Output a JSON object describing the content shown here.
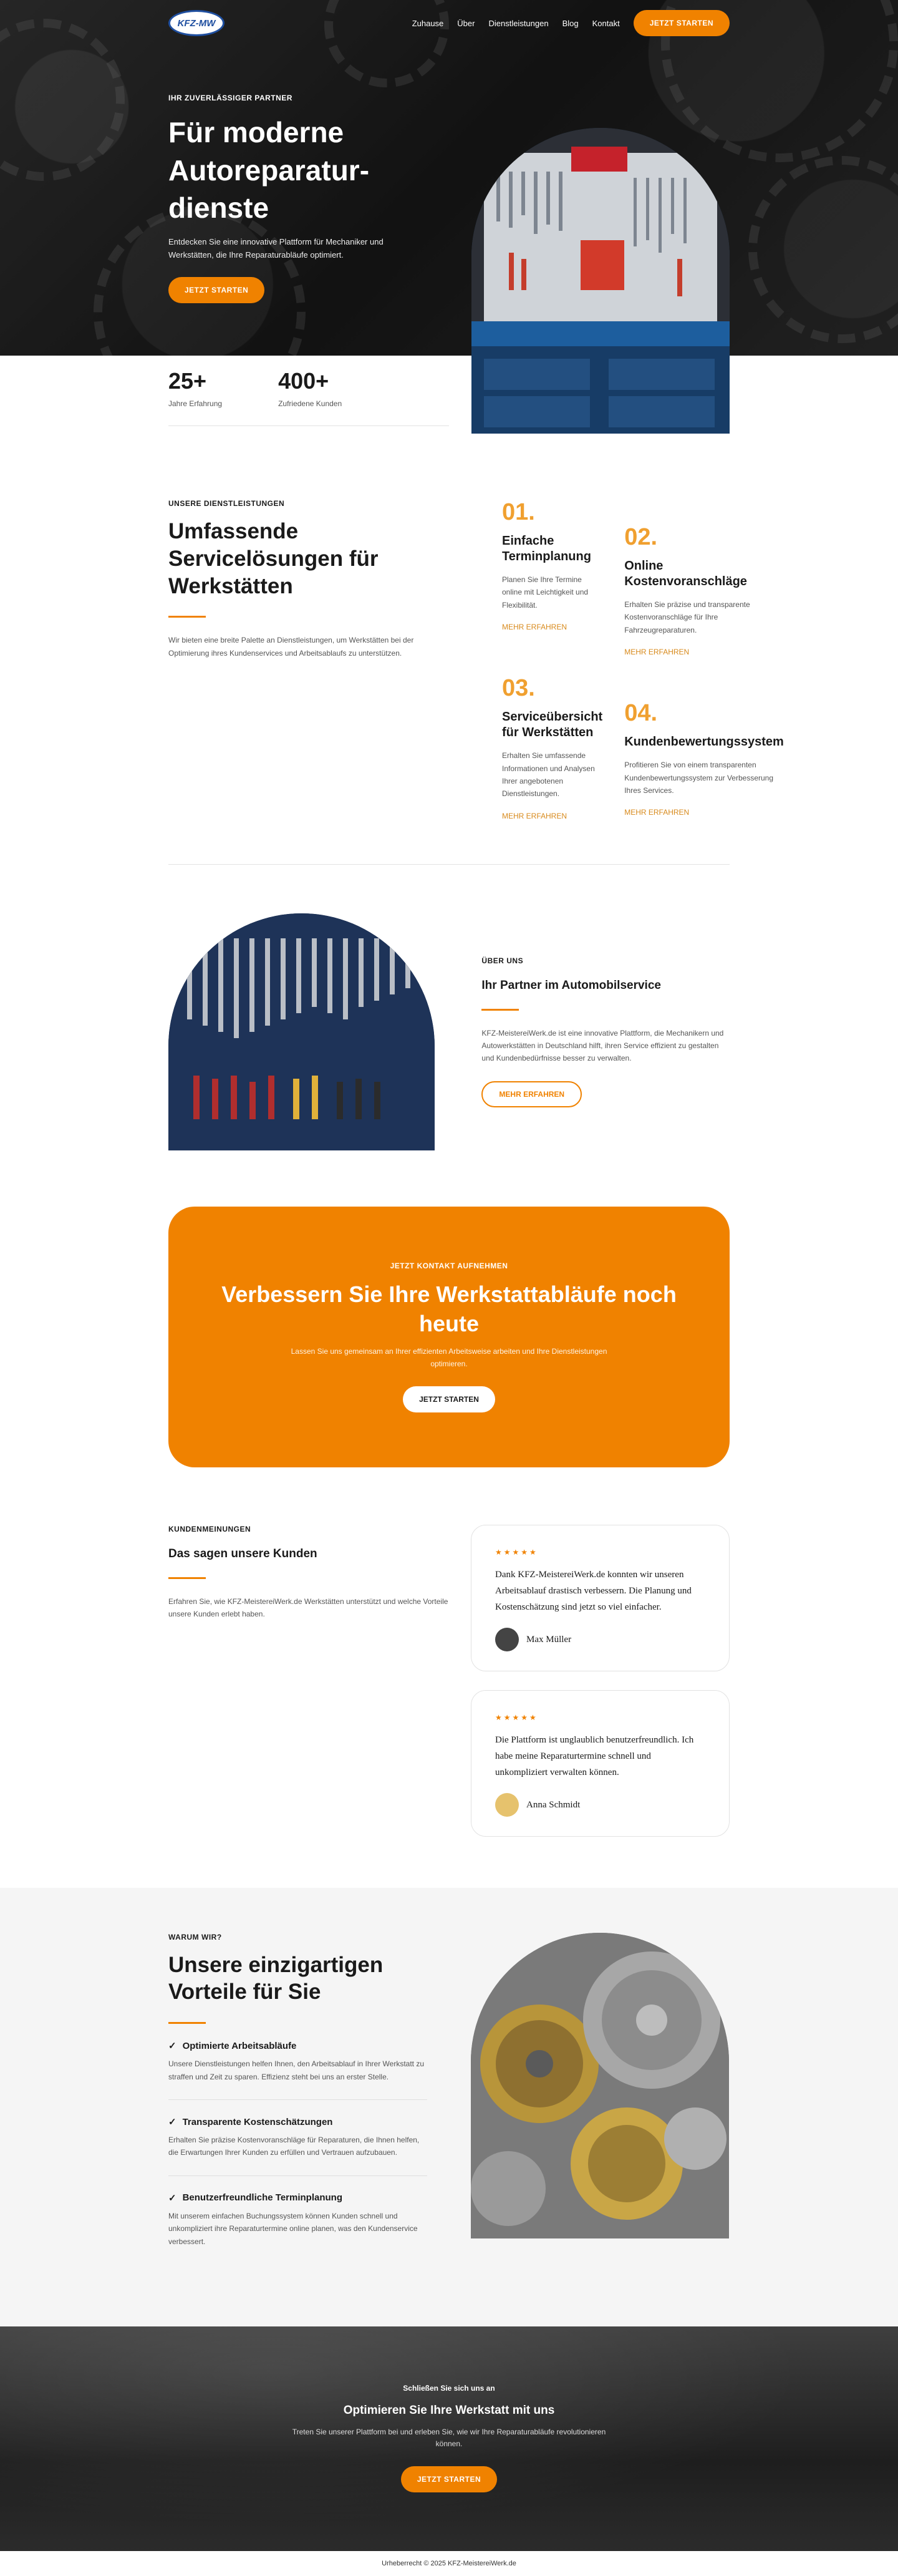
{
  "brand": {
    "logo_text": "KFZ-MW"
  },
  "nav": {
    "links": [
      "Zuhause",
      "Über",
      "Dienstleistungen",
      "Blog",
      "Kontakt"
    ],
    "cta": "JETZT STARTEN"
  },
  "hero": {
    "eyebrow": "IHR ZUVERLÄSSIGER PARTNER",
    "title": "Für moderne Autoreparatur-dienste",
    "description": "Entdecken Sie eine innovative Plattform für Mechaniker und Werkstätten, die Ihre Reparaturabläufe optimiert.",
    "button": "JETZT STARTEN"
  },
  "stats": [
    {
      "value": "25+",
      "label": "Jahre Erfahrung"
    },
    {
      "value": "400+",
      "label": "Zufriedene Kunden"
    }
  ],
  "services": {
    "eyebrow": "UNSERE DIENSTLEISTUNGEN",
    "title": "Umfassende Servicelösungen für Werkstätten",
    "description": "Wir bieten eine breite Palette an Dienstleistungen, um Werkstätten bei der Optimierung ihres Kundenservices und Arbeitsablaufs zu unterstützen.",
    "items": [
      {
        "num": "01.",
        "title": "Einfache Terminplanung",
        "desc": "Planen Sie Ihre Termine online mit Leichtigkeit und Flexibilität.",
        "link": "MEHR ERFAHREN"
      },
      {
        "num": "02.",
        "title": "Online Kostenvoranschläge",
        "desc": "Erhalten Sie präzise und transparente Kostenvoranschläge für Ihre Fahrzeugreparaturen.",
        "link": "MEHR ERFAHREN"
      },
      {
        "num": "03.",
        "title": "Serviceübersicht für Werkstätten",
        "desc": "Erhalten Sie umfassende Informationen und Analysen Ihrer angebotenen Dienstleistungen.",
        "link": "MEHR ERFAHREN"
      },
      {
        "num": "04.",
        "title": "Kundenbewertungssystem",
        "desc": "Profitieren Sie von einem transparenten Kundenbewertungssystem zur Verbesserung Ihres Services.",
        "link": "MEHR ERFAHREN"
      }
    ]
  },
  "about": {
    "eyebrow": "ÜBER UNS",
    "title": "Ihr Partner im Automobilservice",
    "description": "KFZ-MeistereiWerk.de ist eine innovative Plattform, die Mechanikern und Autowerkstätten in Deutschland hilft, ihren Service effizient zu gestalten und Kundenbedürfnisse besser zu verwalten.",
    "button": "MEHR ERFAHREN"
  },
  "cta": {
    "eyebrow": "JETZT KONTAKT AUFNEHMEN",
    "title": "Verbessern Sie Ihre Werkstattabläufe noch heute",
    "description": "Lassen Sie uns gemeinsam an Ihrer effizienten Arbeitsweise arbeiten und Ihre Dienstleistungen optimieren.",
    "button": "JETZT STARTEN"
  },
  "testimonials": {
    "eyebrow": "KUNDENMEINUNGEN",
    "title": "Das sagen unsere Kunden",
    "description": "Erfahren Sie, wie KFZ-MeistereiWerk.de Werkstätten unterstützt und welche Vorteile unsere Kunden erlebt haben.",
    "items": [
      {
        "stars": "★★★★★",
        "quote": "Dank KFZ-MeistereiWerk.de konnten wir unseren Arbeitsablauf drastisch verbessern. Die Planung und Kostenschätzung sind jetzt so viel einfacher.",
        "name": "Max Müller"
      },
      {
        "stars": "★★★★★",
        "quote": "Die Plattform ist unglaublich benutzerfreundlich. Ich habe meine Reparaturtermine schnell und unkompliziert verwalten können.",
        "name": "Anna Schmidt"
      }
    ]
  },
  "advantages": {
    "eyebrow": "WARUM WIR?",
    "title": "Unsere einzigartigen Vorteile für Sie",
    "items": [
      {
        "title": "Optimierte Arbeitsabläufe",
        "desc": "Unsere Dienstleistungen helfen Ihnen, den Arbeitsablauf in Ihrer Werkstatt zu straffen und Zeit zu sparen. Effizienz steht bei uns an erster Stelle."
      },
      {
        "title": "Transparente Kostenschätzungen",
        "desc": "Erhalten Sie präzise Kostenvoranschläge für Reparaturen, die Ihnen helfen, die Erwartungen Ihrer Kunden zu erfüllen und Vertrauen aufzubauen."
      },
      {
        "title": "Benutzerfreundliche Terminplanung",
        "desc": "Mit unserem einfachen Buchungssystem können Kunden schnell und unkompliziert ihre Reparaturtermine online planen, was den Kundenservice verbessert."
      }
    ]
  },
  "final_cta": {
    "eyebrow": "Schließen Sie sich uns an",
    "title": "Optimieren Sie Ihre Werkstatt mit uns",
    "description": "Treten Sie unserer Plattform bei und erleben Sie, wie wir Ihre Reparaturabläufe revolutionieren können.",
    "button": "JETZT STARTEN"
  },
  "footer": {
    "text": "Urheberrecht © 2025 KFZ-MeistereiWerk.de"
  },
  "colors": {
    "accent": "#f08200",
    "dark": "#1a1a1a",
    "light_bg": "#f5f5f5"
  }
}
